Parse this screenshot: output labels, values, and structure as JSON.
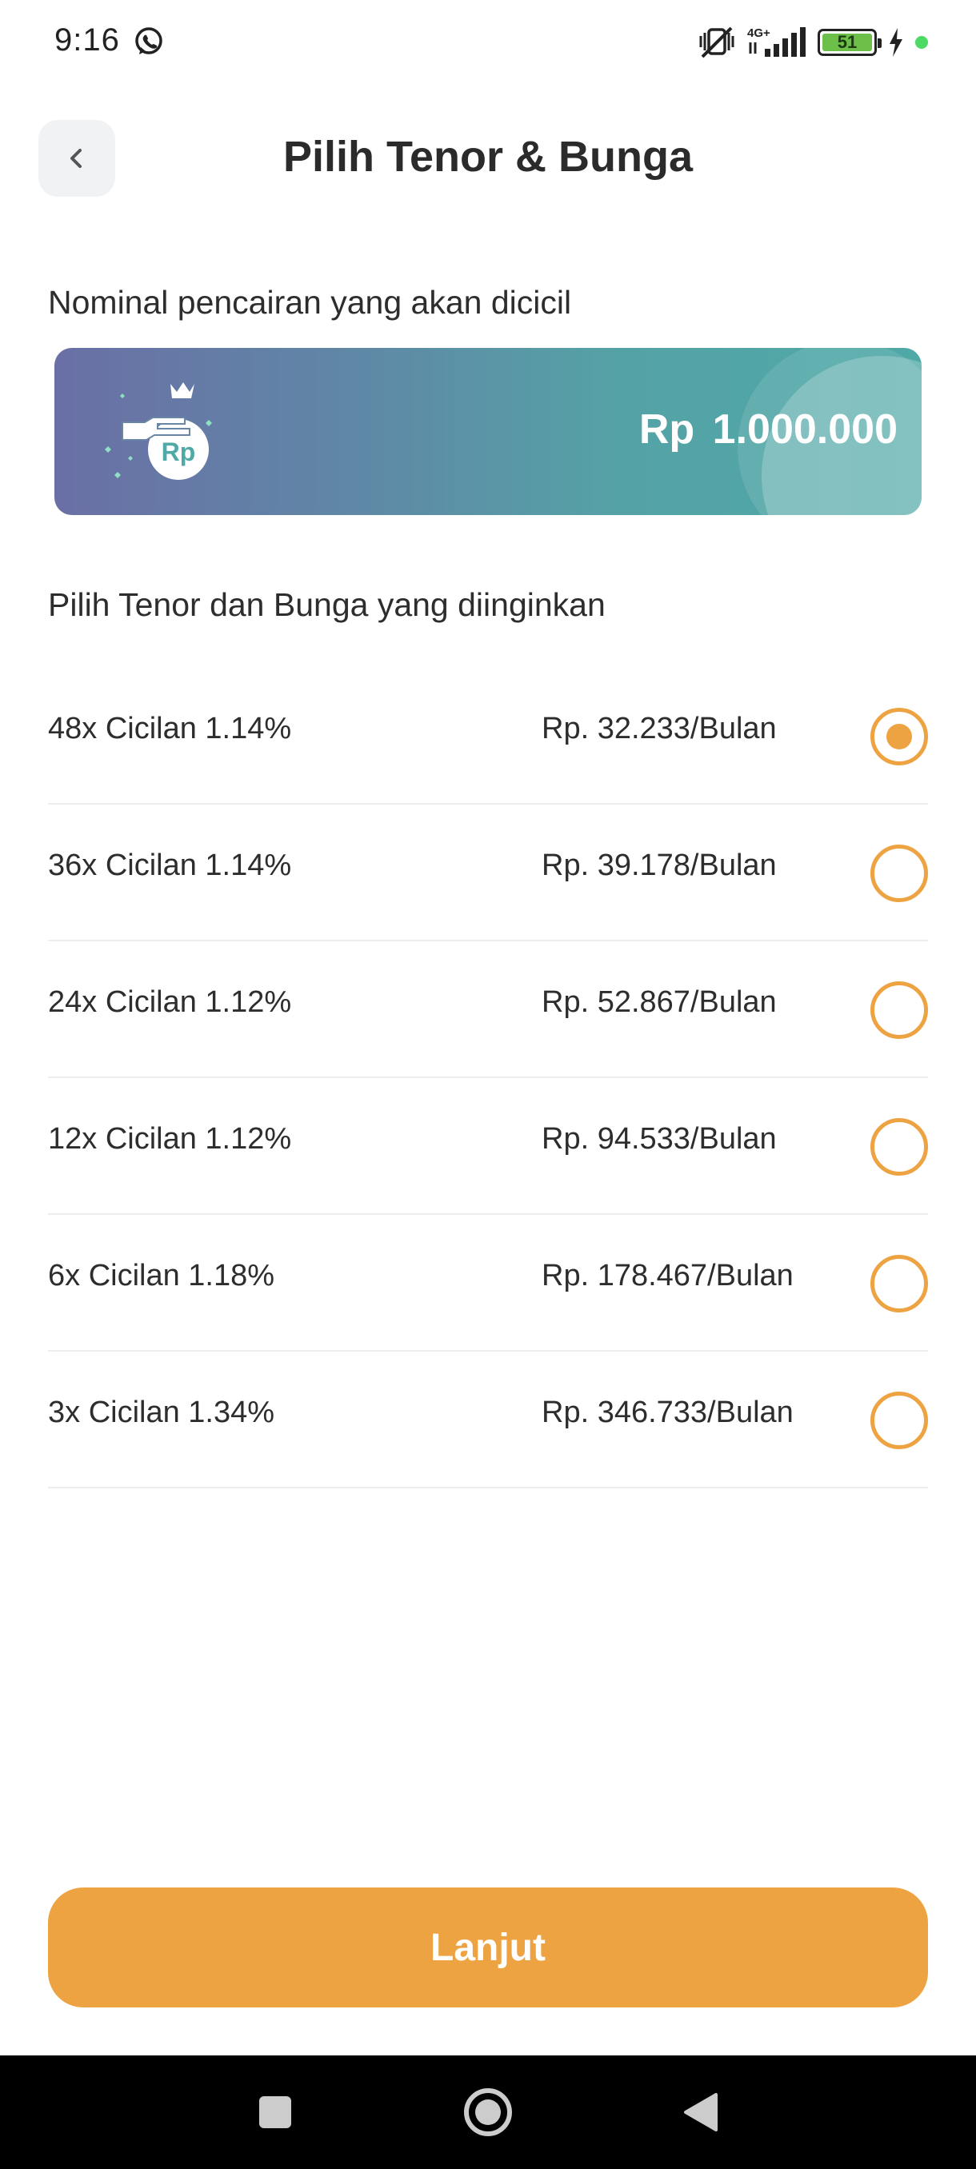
{
  "status_bar": {
    "time": "9:16",
    "battery_level": "51",
    "icons": [
      "whatsapp-icon",
      "mute-vibrate-icon",
      "4g-signal-icon",
      "battery-icon",
      "charging-icon"
    ]
  },
  "header": {
    "title": "Pilih Tenor & Bunga",
    "back_icon": "chevron-left-icon"
  },
  "amount_section": {
    "label": "Nominal pencairan yang akan dicicil",
    "currency": "Rp",
    "amount": "1.000.000",
    "icon": "money-bag-hand-icon",
    "icon_text": "Rp"
  },
  "options_section": {
    "label": "Pilih Tenor dan Bunga yang diinginkan",
    "items": [
      {
        "label": "48x Cicilan 1.14%",
        "price": "Rp. 32.233/Bulan",
        "selected": true
      },
      {
        "label": "36x Cicilan 1.14%",
        "price": "Rp. 39.178/Bulan",
        "selected": false
      },
      {
        "label": "24x Cicilan 1.12%",
        "price": "Rp. 52.867/Bulan",
        "selected": false
      },
      {
        "label": "12x Cicilan 1.12%",
        "price": "Rp. 94.533/Bulan",
        "selected": false
      },
      {
        "label": "6x Cicilan 1.18%",
        "price": "Rp. 178.467/Bulan",
        "selected": false
      },
      {
        "label": "3x Cicilan 1.34%",
        "price": "Rp. 346.733/Bulan",
        "selected": false
      }
    ]
  },
  "footer": {
    "next_label": "Lanjut"
  },
  "colors": {
    "accent": "#eda341",
    "card_gradient_start": "#6a6fa5",
    "card_gradient_end": "#4fa9a6",
    "title": "#2b2b2b"
  }
}
